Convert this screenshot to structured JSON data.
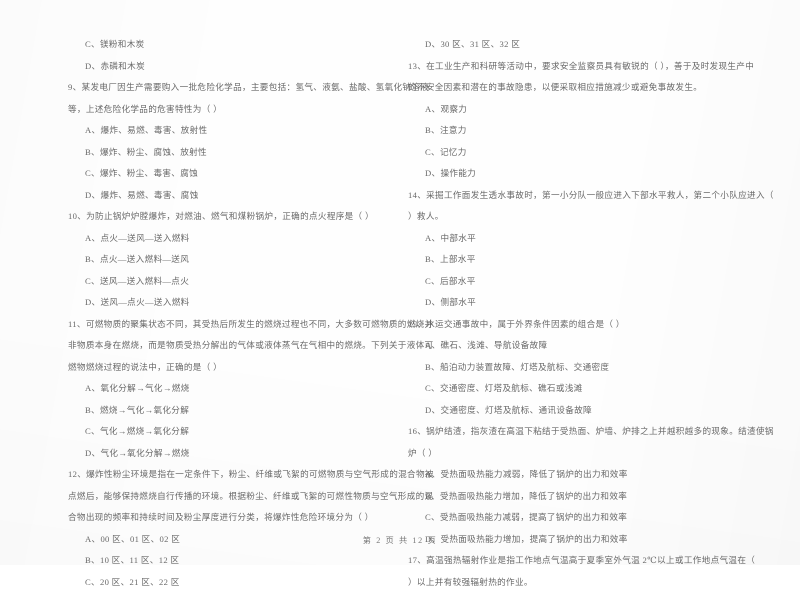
{
  "page": {
    "footer": "第 2 页 共 12 页",
    "text_color": "#5d5d5d",
    "background_color": "#fefefe"
  },
  "left_column": {
    "lines": [
      {
        "kind": "opt",
        "text": "C、镁粉和木炭"
      },
      {
        "kind": "opt",
        "text": "D、赤磷和木炭"
      },
      {
        "kind": "stem",
        "text": "9、某发电厂因生产需要购入一批危险化学品，主要包括：氢气、液氨、盐酸、氢氧化钠溶液"
      },
      {
        "kind": "cont",
        "text": "等，上述危险化学品的危害特性为（    ）"
      },
      {
        "kind": "opt",
        "text": "A、爆炸、易燃、毒害、放射性"
      },
      {
        "kind": "opt",
        "text": "B、爆炸、粉尘、腐蚀、放射性"
      },
      {
        "kind": "opt",
        "text": "C、爆炸、粉尘、毒害、腐蚀"
      },
      {
        "kind": "opt",
        "text": "D、爆炸、易燃、毒害、腐蚀"
      },
      {
        "kind": "stem",
        "text": "10、为防止锅炉炉膛爆炸，对燃油、燃气和煤粉锅炉，正确的点火程序是（    ）"
      },
      {
        "kind": "opt",
        "text": "A、点火—送风—送入燃料"
      },
      {
        "kind": "opt",
        "text": "B、点火—送入燃料—送风"
      },
      {
        "kind": "opt",
        "text": "C、送风—送入燃料—点火"
      },
      {
        "kind": "opt",
        "text": "D、送风—点火—送入燃料"
      },
      {
        "kind": "stem",
        "text": "11、可燃物质的聚集状态不同，其受热后所发生的燃烧过程也不同，大多数可燃物质的燃烧并"
      },
      {
        "kind": "cont",
        "text": "非物质本身在燃烧，而是物质受热分解出的气体或液体蒸气在气相中的燃烧。下列关于液体可"
      },
      {
        "kind": "cont",
        "text": "燃物燃烧过程的说法中，正确的是（    ）"
      },
      {
        "kind": "opt",
        "text": "A、氧化分解→气化→燃烧"
      },
      {
        "kind": "opt",
        "text": "B、燃烧→气化→氧化分解"
      },
      {
        "kind": "opt",
        "text": "C、气化→燃烧→氧化分解"
      },
      {
        "kind": "opt",
        "text": "D、气化→氧化分解→燃烧"
      },
      {
        "kind": "stem",
        "text": "12、爆炸性粉尘环境是指在一定条件下，粉尘、纤维或飞絮的可燃物质与空气形成的混合物被"
      },
      {
        "kind": "cont",
        "text": "点燃后，能够保持燃烧自行传播的环境。根据粉尘、纤维或飞絮的可燃性物质与空气形成的混"
      },
      {
        "kind": "cont",
        "text": "合物出现的频率和持续时间及粉尘厚度进行分类，将爆炸性危险环境分为（    ）"
      },
      {
        "kind": "opt",
        "text": "A、00 区、01 区、02 区"
      },
      {
        "kind": "opt",
        "text": "B、10 区、11 区、12 区"
      },
      {
        "kind": "opt",
        "text": "C、20 区、21 区、22 区"
      }
    ]
  },
  "right_column": {
    "lines": [
      {
        "kind": "opt",
        "text": "D、30 区、31 区、32 区"
      },
      {
        "kind": "stem",
        "text": "13、在工业生产和科研等活动中，要求安全监察员具有敏锐的（    ），善于及时发现生产中"
      },
      {
        "kind": "cont",
        "text": "的不安全因素和潜在的事故隐患，以便采取相应措施减少或避免事故发生。"
      },
      {
        "kind": "opt",
        "text": "A、观察力"
      },
      {
        "kind": "opt",
        "text": "B、注意力"
      },
      {
        "kind": "opt",
        "text": "C、记忆力"
      },
      {
        "kind": "opt",
        "text": "D、操作能力"
      },
      {
        "kind": "stem",
        "text": "14、采掘工作面发生透水事故时，第一小分队一般应进入下部水平救人，第二个小队应进入（"
      },
      {
        "kind": "cont",
        "text": "）救人。"
      },
      {
        "kind": "opt",
        "text": "A、中部水平"
      },
      {
        "kind": "opt",
        "text": "B、上部水平"
      },
      {
        "kind": "opt",
        "text": "C、后部水平"
      },
      {
        "kind": "opt",
        "text": "D、侧部水平"
      },
      {
        "kind": "stem",
        "text": "15、水运交通事故中，属于外界条件因素的组合是（    ）"
      },
      {
        "kind": "opt",
        "text": "A、礁石、浅滩、导航设备故障"
      },
      {
        "kind": "opt",
        "text": "B、船泊动力装置故障、灯塔及航标、交通密度"
      },
      {
        "kind": "opt",
        "text": "C、交通密度、灯塔及航标、礁石或浅滩"
      },
      {
        "kind": "opt",
        "text": "D、交通密度、灯塔及航标、通讯设备故障"
      },
      {
        "kind": "stem",
        "text": "16、锅炉结渣，指灰渣在高温下粘结于受热面、炉墙、炉排之上并越积越多的现象。结渣使锅"
      },
      {
        "kind": "cont",
        "text": "炉（    ）"
      },
      {
        "kind": "opt",
        "text": "A、受热面吸热能力减弱，降低了锅炉的出力和效率"
      },
      {
        "kind": "opt",
        "text": "B、受热面吸热能力增加，降低了锅炉的出力和效率"
      },
      {
        "kind": "opt",
        "text": "C、受热面吸热能力减弱，提高了锅炉的出力和效率"
      },
      {
        "kind": "opt",
        "text": "D、受热面吸热能力增加，提高了锅炉的出力和效率"
      },
      {
        "kind": "stem",
        "text": "17、高温强热辐射作业是指工作地点气温高于夏季室外气温 2℃以上或工作地点气温在（"
      },
      {
        "kind": "cont",
        "text": "）以上并有较强辐射热的作业。"
      }
    ]
  }
}
